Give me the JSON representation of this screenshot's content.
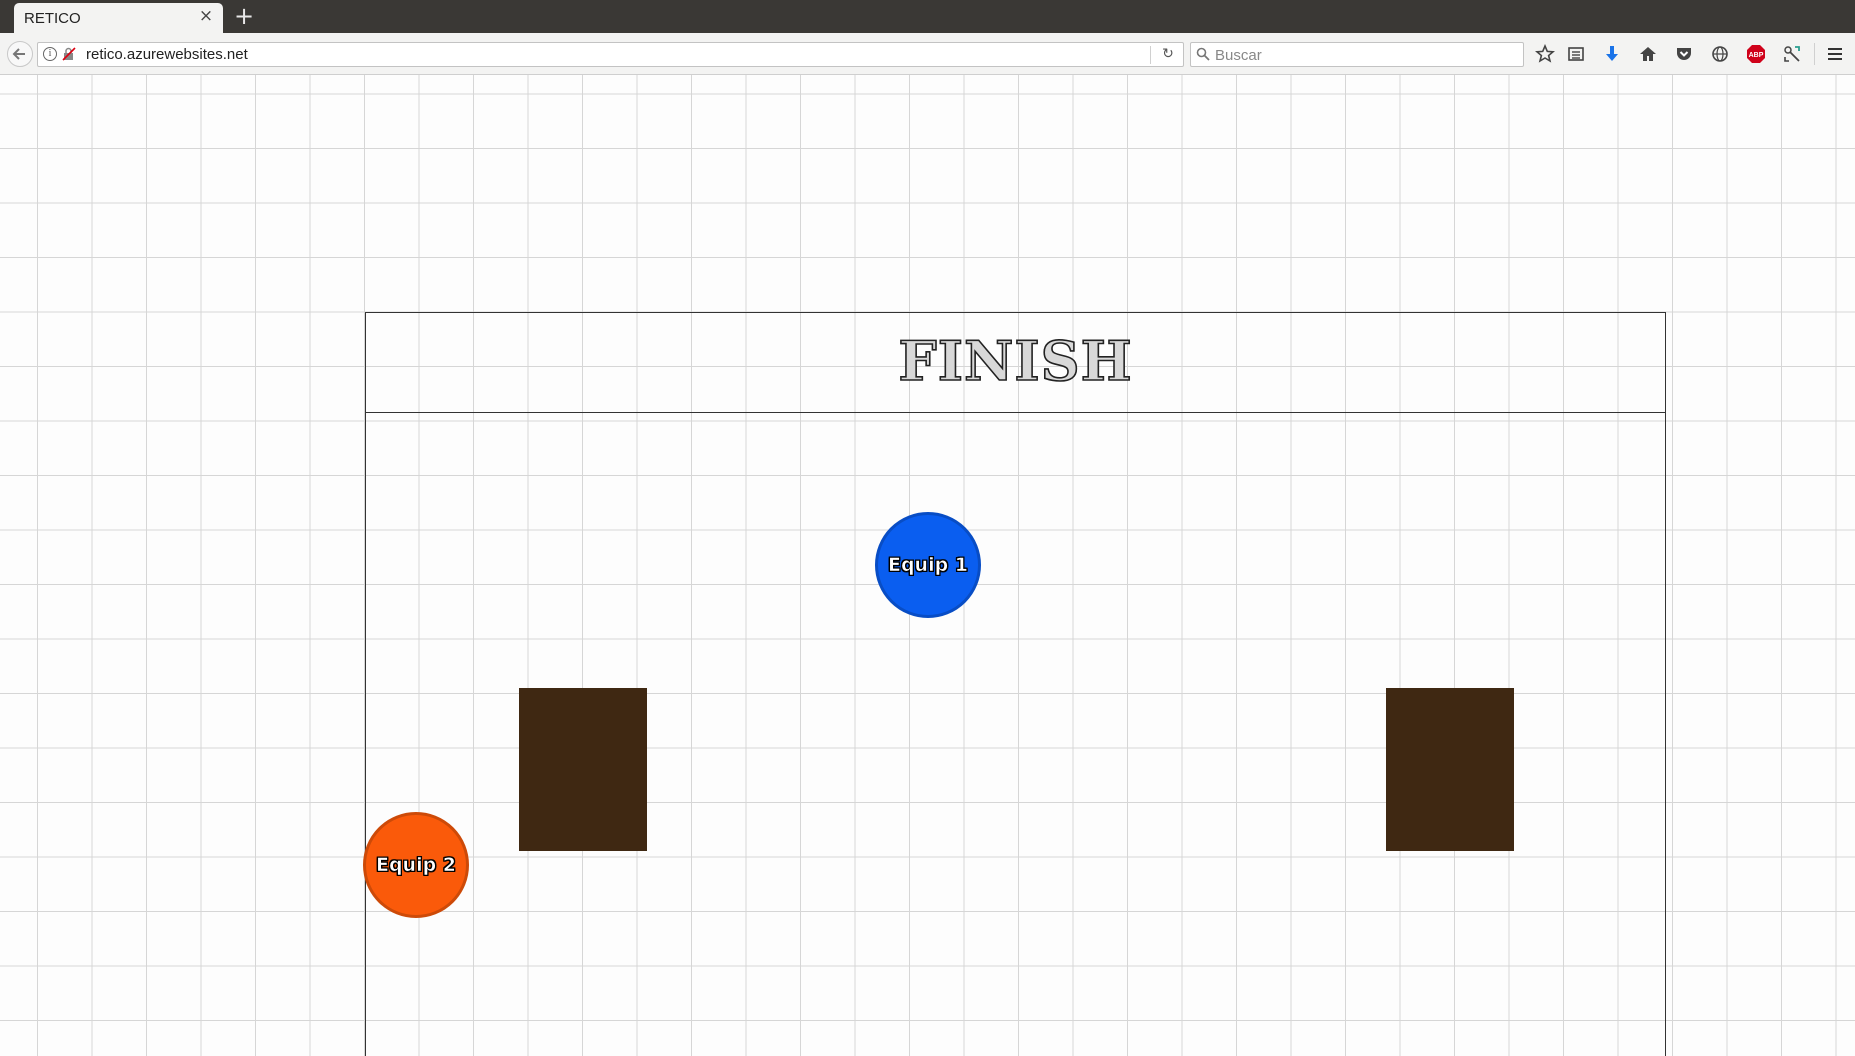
{
  "browser": {
    "tab_title": "RETICO",
    "tab_close": "×",
    "new_tab": "+",
    "url": "retico.azurewebsites.net",
    "search_placeholder": "Buscar",
    "toolbar_icons": [
      "star-icon",
      "reading-list-icon",
      "download-icon",
      "home-icon",
      "pocket-icon",
      "globe-icon",
      "adblock-icon",
      "extension-icon",
      "menu-icon"
    ],
    "adblock_label": "ABP"
  },
  "game": {
    "finish_label": "FINISH",
    "players": [
      {
        "name": "Equip 1",
        "color": "#0a5ef0"
      },
      {
        "name": "Equip 2",
        "color": "#fa5a0a"
      }
    ],
    "obstacle_color": "#3f2812"
  }
}
